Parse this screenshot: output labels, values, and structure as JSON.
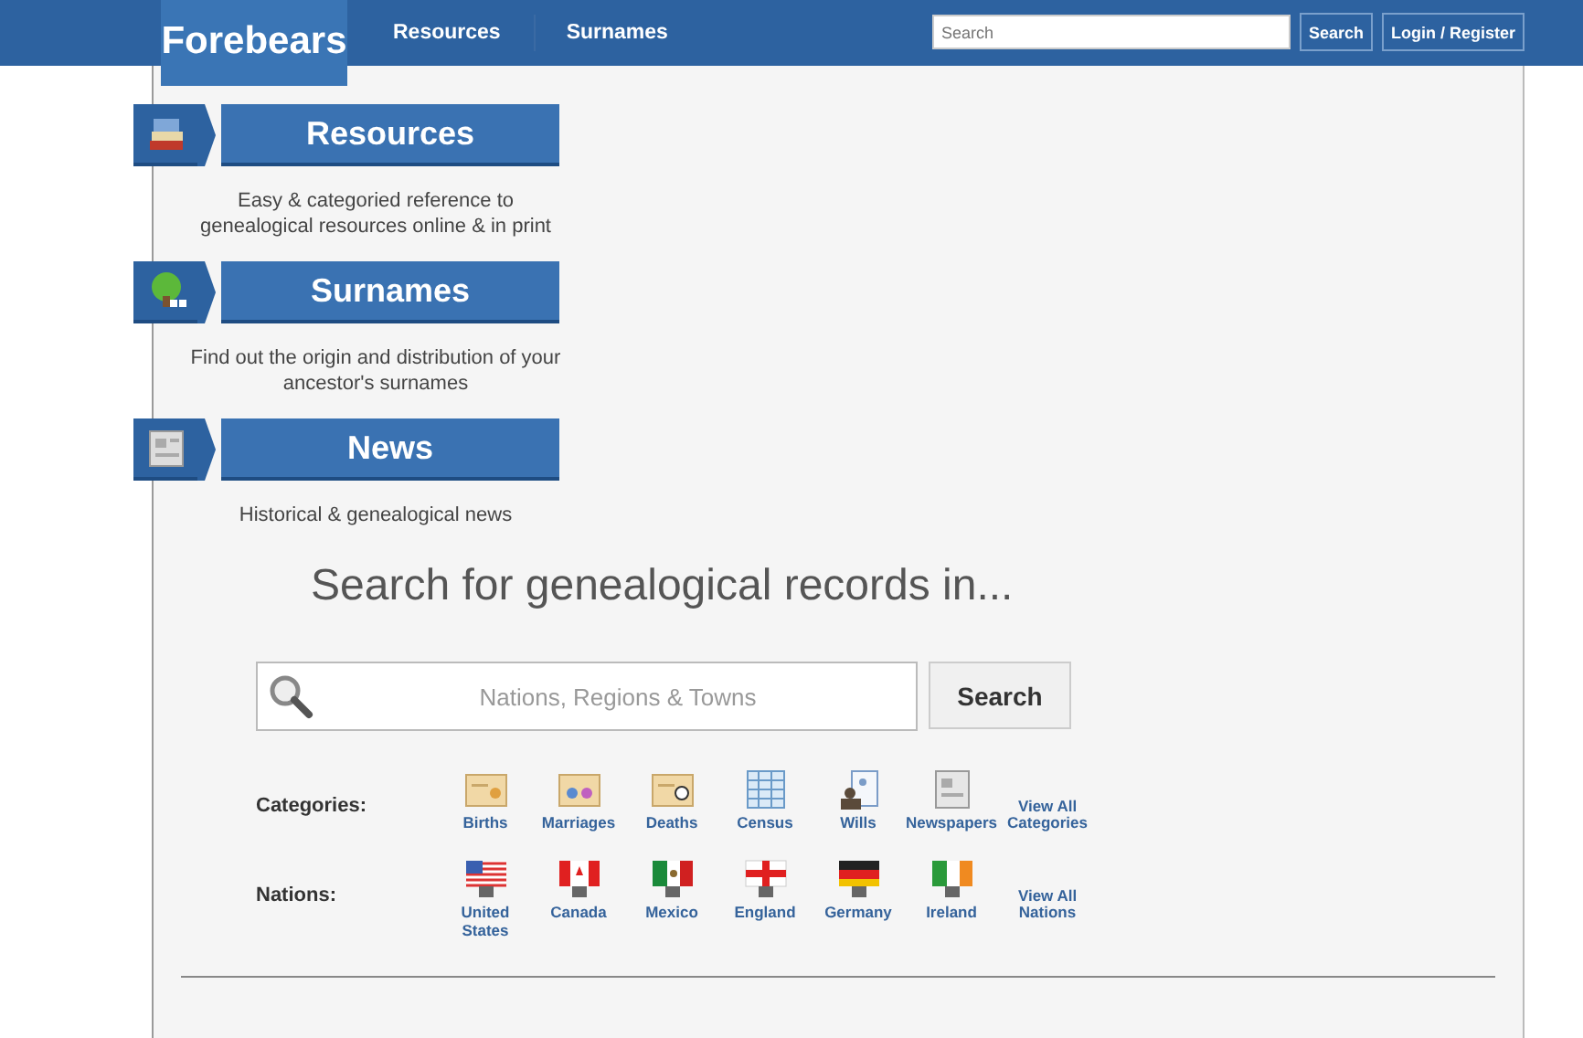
{
  "header": {
    "logo": "Forebears",
    "nav": [
      "Resources",
      "Surnames"
    ],
    "search": {
      "placeholder": "Search"
    },
    "search_button": "Search",
    "login_button": "Login / Register"
  },
  "sections": [
    {
      "kind": "books",
      "title": "Resources",
      "description": "Easy & categoried reference to genealogical resources online & in print"
    },
    {
      "kind": "tree",
      "title": "Surnames",
      "description": "Find out the origin and distribution of your ancestor's surnames"
    },
    {
      "kind": "newspaper",
      "title": "News",
      "description": "Historical & genealogical news"
    }
  ],
  "record_search": {
    "heading": "Search for genealogical records in...",
    "placeholder": "Nations, Regions & Towns",
    "button": "Search"
  },
  "categories": {
    "label": "Categories:",
    "items": [
      {
        "kind": "birth",
        "label": "Births"
      },
      {
        "kind": "marriage",
        "label": "Marriages"
      },
      {
        "kind": "death",
        "label": "Deaths"
      },
      {
        "kind": "census",
        "label": "Census"
      },
      {
        "kind": "will",
        "label": "Wills"
      },
      {
        "kind": "newspaper",
        "label": "Newspapers"
      }
    ],
    "view_all": "View All Categories"
  },
  "nations": {
    "label": "Nations:",
    "items": [
      {
        "kind": "us",
        "label": "United States"
      },
      {
        "kind": "ca",
        "label": "Canada"
      },
      {
        "kind": "mx",
        "label": "Mexico"
      },
      {
        "kind": "gb",
        "label": "England"
      },
      {
        "kind": "de",
        "label": "Germany"
      },
      {
        "kind": "ie",
        "label": "Ireland"
      }
    ],
    "view_all": "View All Nations"
  }
}
